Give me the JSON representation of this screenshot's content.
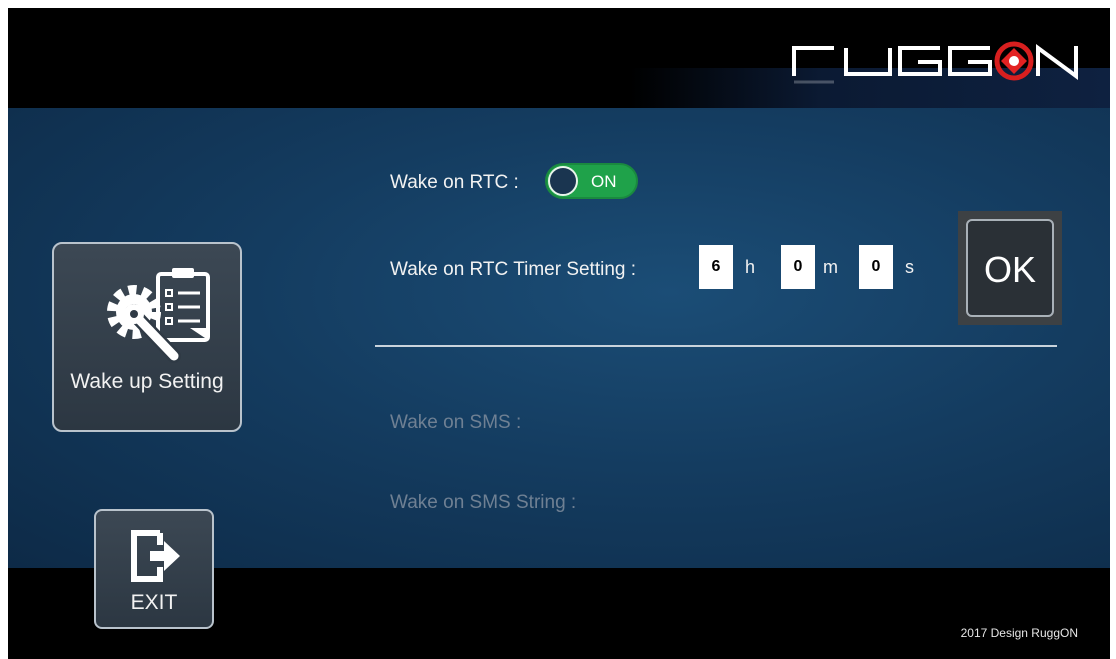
{
  "brand": {
    "logo_text": "RuggON"
  },
  "sidebar": {
    "wake_button_label": "Wake up Setting",
    "exit_label": "EXIT"
  },
  "rtc": {
    "label": "Wake on RTC :",
    "toggle_state": "ON",
    "timer_label": "Wake on RTC Timer Setting :",
    "hours": "6",
    "hours_unit": "h",
    "minutes": "0",
    "minutes_unit": "m",
    "seconds": "0",
    "seconds_unit": "s",
    "ok_label": "OK"
  },
  "sms": {
    "label": "Wake on SMS :",
    "string_label": "Wake on SMS String :"
  },
  "footer": {
    "copyright": "2017 Design RuggON"
  },
  "colors": {
    "toggle_on": "#1fa24a",
    "panel_bg": "#143c60",
    "logo_red": "#e32222"
  }
}
